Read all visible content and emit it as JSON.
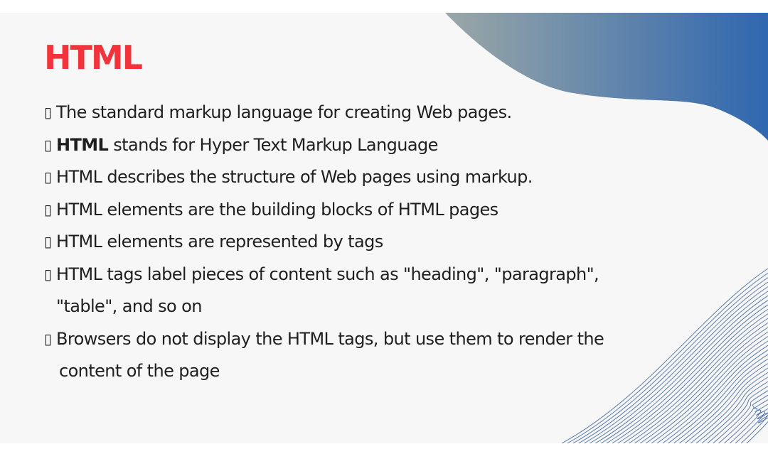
{
  "title": "HTML",
  "bullet_marker": "▯",
  "bullets": [
    {
      "text": "The standard markup language for creating Web pages."
    },
    {
      "bold": "HTML",
      "text": " stands for Hyper Text Markup Language"
    },
    {
      "text": "HTML describes the structure of Web pages using markup."
    },
    {
      "text": "HTML elements are the building blocks of HTML pages"
    },
    {
      "text": "HTML elements are represented by tags"
    },
    {
      "text": "HTML tags label pieces of content such as \"heading\", \"paragraph\",",
      "continuation": "\"table\", and so on"
    },
    {
      "text": "Browsers do not display the HTML tags, but use them to render the",
      "continuation": "content of the page"
    }
  ],
  "colors": {
    "title": "#f2333b",
    "text": "#1f1f1f",
    "background": "#f7f7f7",
    "blob_start": "#9aa7a7",
    "blob_end": "#2f67b0",
    "waves": "#2f5a9e"
  }
}
